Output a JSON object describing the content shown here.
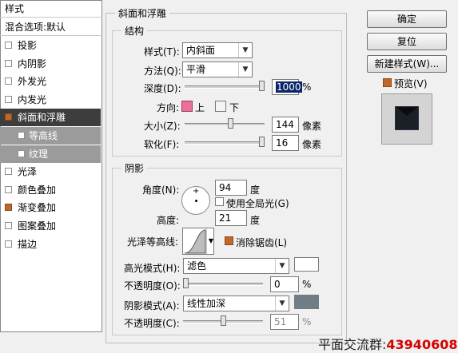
{
  "sidebar": {
    "title": "样式",
    "blend_options": "混合选项:默认",
    "items": [
      {
        "label": "投影",
        "checked": false
      },
      {
        "label": "内阴影",
        "checked": false
      },
      {
        "label": "外发光",
        "checked": false
      },
      {
        "label": "内发光",
        "checked": false
      },
      {
        "label": "斜面和浮雕",
        "checked": true,
        "selected": true
      },
      {
        "label": "等高线",
        "checked": false,
        "sub": true
      },
      {
        "label": "纹理",
        "checked": false,
        "sub": true
      },
      {
        "label": "光泽",
        "checked": false
      },
      {
        "label": "颜色叠加",
        "checked": false
      },
      {
        "label": "渐变叠加",
        "checked": true
      },
      {
        "label": "图案叠加",
        "checked": false
      },
      {
        "label": "描边",
        "checked": false
      }
    ]
  },
  "bevel": {
    "section_title": "斜面和浮雕",
    "structure_title": "结构",
    "style_label": "样式(T):",
    "style_value": "内斜面",
    "technique_label": "方法(Q):",
    "technique_value": "平滑",
    "depth_label": "深度(D):",
    "depth_value": "1000",
    "depth_unit": "%",
    "depth_level": 1.0,
    "direction_label": "方向:",
    "direction_up": "上",
    "direction_down": "下",
    "size_label": "大小(Z):",
    "size_value": "144",
    "size_unit": "像素",
    "size_level": 0.58,
    "soften_label": "软化(F):",
    "soften_value": "16",
    "soften_unit": "像素",
    "soften_level": 1.0
  },
  "shading": {
    "title": "阴影",
    "angle_label": "角度(N):",
    "angle_value": "94",
    "angle_unit": "度",
    "global_light_label": "使用全局光(G)",
    "altitude_label": "高度:",
    "altitude_value": "21",
    "altitude_unit": "度",
    "gloss_label": "光泽等高线:",
    "anti_alias_label": "消除锯齿(L)",
    "highlight_mode_label": "高光模式(H):",
    "highlight_mode_value": "滤色",
    "highlight_color": "#ffffff",
    "highlight_opacity_label": "不透明度(O):",
    "highlight_opacity_value": "0",
    "highlight_opacity_unit": "%",
    "highlight_opacity_level": 0.0,
    "shadow_mode_label": "阴影模式(A):",
    "shadow_mode_value": "线性加深",
    "shadow_color": "#6f7d86",
    "shadow_opacity_label": "不透明度(C):",
    "shadow_opacity_value": "51",
    "shadow_opacity_unit": "%",
    "shadow_opacity_level": 0.51
  },
  "buttons": {
    "ok": "确定",
    "reset": "复位",
    "new_style": "新建样式(W)...",
    "preview": "预览(V)"
  },
  "watermark": {
    "text": "平面交流群:",
    "number": "43940608"
  }
}
